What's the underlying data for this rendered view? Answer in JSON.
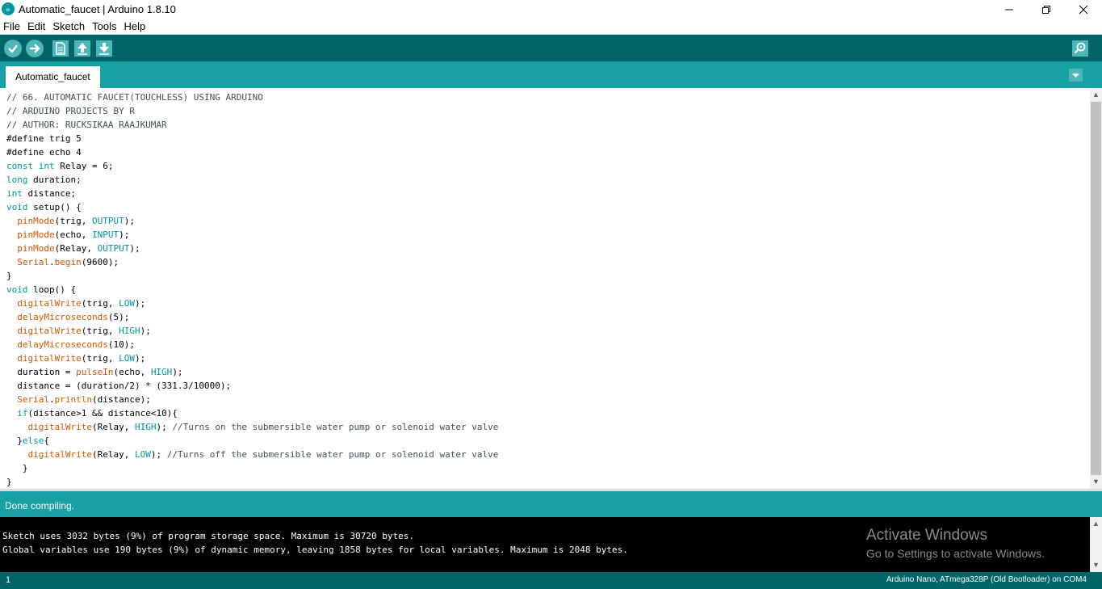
{
  "window": {
    "title": "Automatic_faucet | Arduino 1.8.10",
    "controls": {
      "minimize": "—",
      "maximize": "❐",
      "close": "✕"
    }
  },
  "menu": [
    "File",
    "Edit",
    "Sketch",
    "Tools",
    "Help"
  ],
  "toolbar": {
    "buttons": [
      "verify",
      "upload",
      "new",
      "open",
      "save"
    ],
    "serial_monitor": "serial-monitor"
  },
  "tabs": [
    {
      "label": "Automatic_faucet",
      "active": true
    }
  ],
  "editor": {
    "lines": [
      "// 66. AUTOMATIC FAUCET(TOUCHLESS) USING ARDUINO",
      "// ARDUINO PROJECTS BY R",
      "// AUTHOR: RUCKSIKAA RAAJKUMAR",
      "#define trig 5",
      "#define echo 4",
      "const int Relay = 6;",
      "long duration;",
      "int distance;",
      "void setup() {",
      "  pinMode(trig, OUTPUT);",
      "  pinMode(echo, INPUT);",
      "  pinMode(Relay, OUTPUT);",
      "  Serial.begin(9600);",
      "}",
      "void loop() {",
      "  digitalWrite(trig, LOW);",
      "  delayMicroseconds(5);",
      "  digitalWrite(trig, HIGH);",
      "  delayMicroseconds(10);",
      "  digitalWrite(trig, LOW);",
      "  duration = pulseIn(echo, HIGH);",
      "  distance = (duration/2) * (331.3/10000);",
      "  Serial.println(distance);",
      "  if(distance>1 && distance<10){",
      "    digitalWrite(Relay, HIGH); //Turns on the submersible water pump or solenoid water valve",
      "  }else{",
      "    digitalWrite(Relay, LOW); //Turns off the submersible water pump or solenoid water valve",
      "   }",
      "}"
    ]
  },
  "status": {
    "message": "Done compiling."
  },
  "console": {
    "lines": [
      "Sketch uses 3032 bytes (9%) of program storage space. Maximum is 30720 bytes.",
      "Global variables use 190 bytes (9%) of dynamic memory, leaving 1858 bytes for local variables. Maximum is 2048 bytes."
    ]
  },
  "watermark": {
    "title": "Activate Windows",
    "subtitle": "Go to Settings to activate Windows."
  },
  "footer": {
    "line_number": "1",
    "board": "Arduino Nano, ATmega328P (Old Bootloader) on COM4"
  },
  "colors": {
    "toolbar": "#006468",
    "tabbar": "#17a1a5",
    "button": "#4db7bb",
    "keyword": "#00979c",
    "function": "#d35400",
    "comment": "#434f54"
  }
}
